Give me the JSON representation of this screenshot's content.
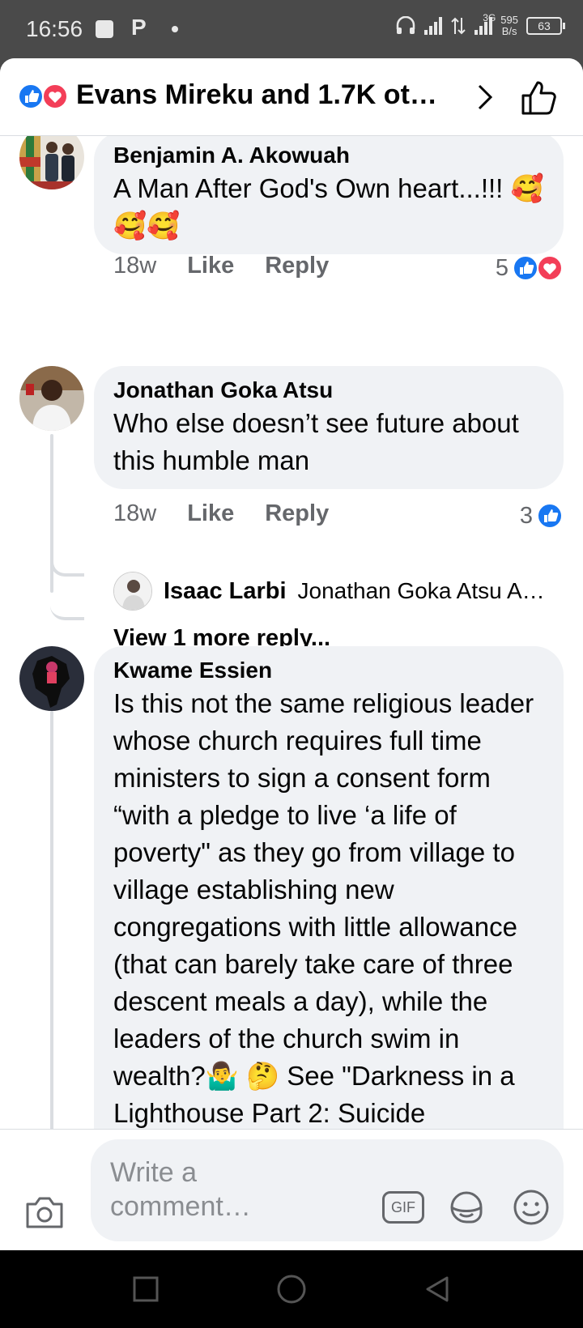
{
  "status": {
    "time": "16:56",
    "p_icon": "P",
    "speed_value": "595",
    "speed_unit": "B/s",
    "network": "3G",
    "battery": "63"
  },
  "header": {
    "title": "Evans Mireku and 1.7K ot…",
    "reactions": [
      "like-icon",
      "love-icon"
    ]
  },
  "comments": [
    {
      "name": "Benjamin A. Akowuah",
      "text": "A Man After God's Own heart...!!! 🥰🥰🥰",
      "time": "18w",
      "like": "Like",
      "reply": "Reply",
      "reaction_count": "5",
      "reactions": [
        "like-icon",
        "love-icon"
      ]
    },
    {
      "name": "Jonathan Goka Atsu",
      "text": "Who else doesn’t see future about this humble man",
      "time": "18w",
      "like": "Like",
      "reply": "Reply",
      "reaction_count": "3",
      "reactions": [
        "like-icon"
      ]
    },
    {
      "name": "Kwame Essien",
      "text": "Is this not the same religious leader whose church requires full time ministers to sign a consent form “with a pledge to live ‘a life of poverty\" as they go from village to village establishing new congregations with little allowance (that can barely take care of three descent meals a day), while the leaders of the church swim in wealth?🤷‍♂️ 🤔 See \"Darkness in a Lighthouse Part 2: Suicide"
    }
  ],
  "reply_preview": {
    "name": "Isaac Larbi",
    "text": "Jonathan Goka Atsu A…"
  },
  "view_more": "View 1 more reply...",
  "composer": {
    "placeholder": "Write a comment…",
    "gif_label": "GIF"
  },
  "colors": {
    "like_blue": "#1877f2",
    "love_red": "#f33e58",
    "bubble": "#f0f2f5",
    "meta_gray": "#65676b"
  }
}
